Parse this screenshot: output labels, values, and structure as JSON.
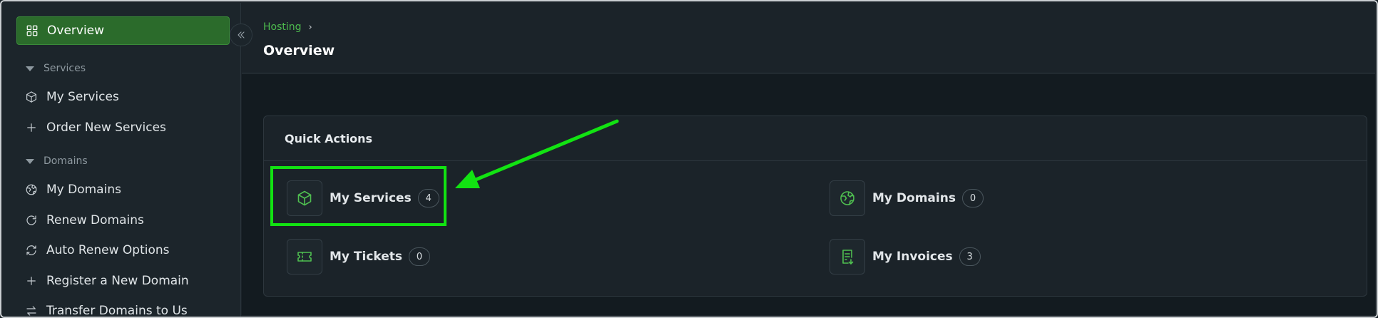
{
  "sidebar": {
    "active_item": {
      "label": "Overview",
      "icon": "grid-icon"
    },
    "sections": [
      {
        "title": "Services",
        "items": [
          {
            "label": "My Services",
            "icon": "cube-icon"
          },
          {
            "label": "Order New Services",
            "icon": "plus-icon"
          }
        ]
      },
      {
        "title": "Domains",
        "items": [
          {
            "label": "My Domains",
            "icon": "globe-icon"
          },
          {
            "label": "Renew Domains",
            "icon": "refresh-icon"
          },
          {
            "label": "Auto Renew Options",
            "icon": "sync-icon"
          },
          {
            "label": "Register a New Domain",
            "icon": "plus-icon"
          },
          {
            "label": "Transfer Domains to Us",
            "icon": "transfer-icon"
          }
        ]
      }
    ]
  },
  "header": {
    "breadcrumb": "Hosting",
    "title": "Overview"
  },
  "quick_actions": {
    "title": "Quick Actions",
    "items": [
      {
        "label": "My Services",
        "count": "4",
        "icon": "cube-icon"
      },
      {
        "label": "My Domains",
        "count": "0",
        "icon": "globe-icon"
      },
      {
        "label": "My Tickets",
        "count": "0",
        "icon": "ticket-icon"
      },
      {
        "label": "My Invoices",
        "count": "3",
        "icon": "invoice-icon"
      }
    ]
  },
  "colors": {
    "accent": "#4dbb4e",
    "active_nav_bg": "#2b6b2b",
    "annotation": "#12e312",
    "background": "#1b2329"
  }
}
